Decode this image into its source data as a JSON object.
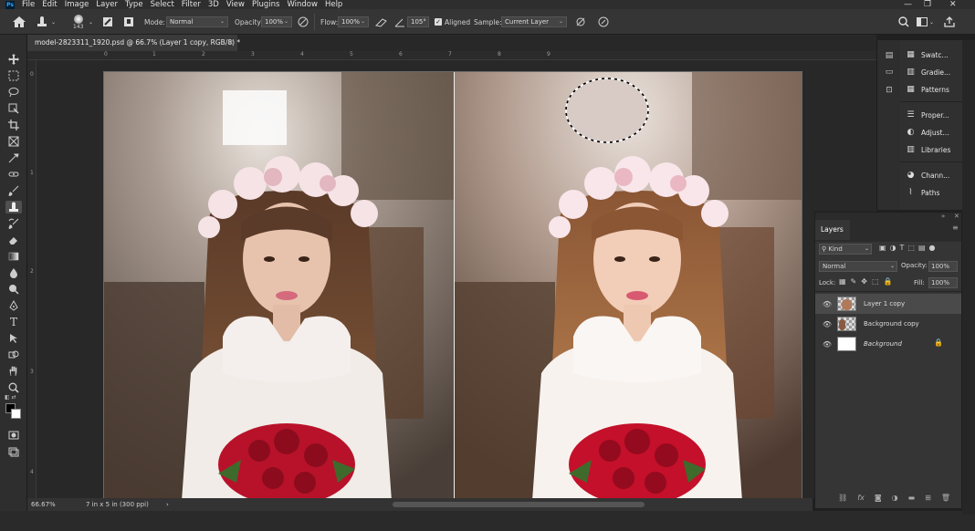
{
  "menu": {
    "items": [
      "File",
      "Edit",
      "Image",
      "Layer",
      "Type",
      "Select",
      "Filter",
      "3D",
      "View",
      "Plugins",
      "Window",
      "Help"
    ]
  },
  "window_controls": {
    "minimize": "—",
    "maximize": "❐",
    "close": "✕"
  },
  "options": {
    "brush_size": "143",
    "mode_label": "Mode:",
    "mode_value": "Normal",
    "opacity_label": "Opacity:",
    "opacity_value": "100%",
    "flow_label": "Flow:",
    "flow_value": "100%",
    "angle_value": "105°",
    "aligned_label": "Aligned",
    "sample_label": "Sample:",
    "sample_value": "Current Layer"
  },
  "document": {
    "tab_title": "model-2823311_1920.psd @ 66.7% (Layer 1 copy, RGB/8) *",
    "tab_close": "×"
  },
  "rulers": {
    "top": [
      "0",
      "1",
      "2",
      "3",
      "4",
      "5",
      "6",
      "7",
      "8",
      "9"
    ],
    "left": [
      "0",
      "1",
      "2",
      "3",
      "4"
    ]
  },
  "status": {
    "zoom": "66.67%",
    "doc_info": "7 in x 5 in (300 ppi)",
    "arrow": "›"
  },
  "right_panels": {
    "group1": [
      "Swatc...",
      "Gradie...",
      "Patterns"
    ],
    "group2": [
      "Proper...",
      "Adjust...",
      "Libraries"
    ],
    "group3": [
      "Chann...",
      "Paths"
    ]
  },
  "layers_panel": {
    "title": "Layers",
    "filter_kind": "Kind",
    "blend_mode": "Normal",
    "opacity_label": "Opacity:",
    "opacity_value": "100%",
    "lock_label": "Lock:",
    "fill_label": "Fill:",
    "fill_value": "100%",
    "layers": [
      {
        "name": "Layer 1 copy",
        "selected": true
      },
      {
        "name": "Background copy",
        "selected": false
      },
      {
        "name": "Background",
        "selected": false,
        "locked": true
      }
    ],
    "footer_icons": [
      "link-icon",
      "fx-icon",
      "mask-icon",
      "adjustment-icon",
      "group-folder-icon",
      "new-layer-icon",
      "trash-icon"
    ]
  },
  "colors": {
    "ui_dark": "#2e2e2e",
    "panel": "#353535",
    "selected_row": "#4a4a4a"
  }
}
